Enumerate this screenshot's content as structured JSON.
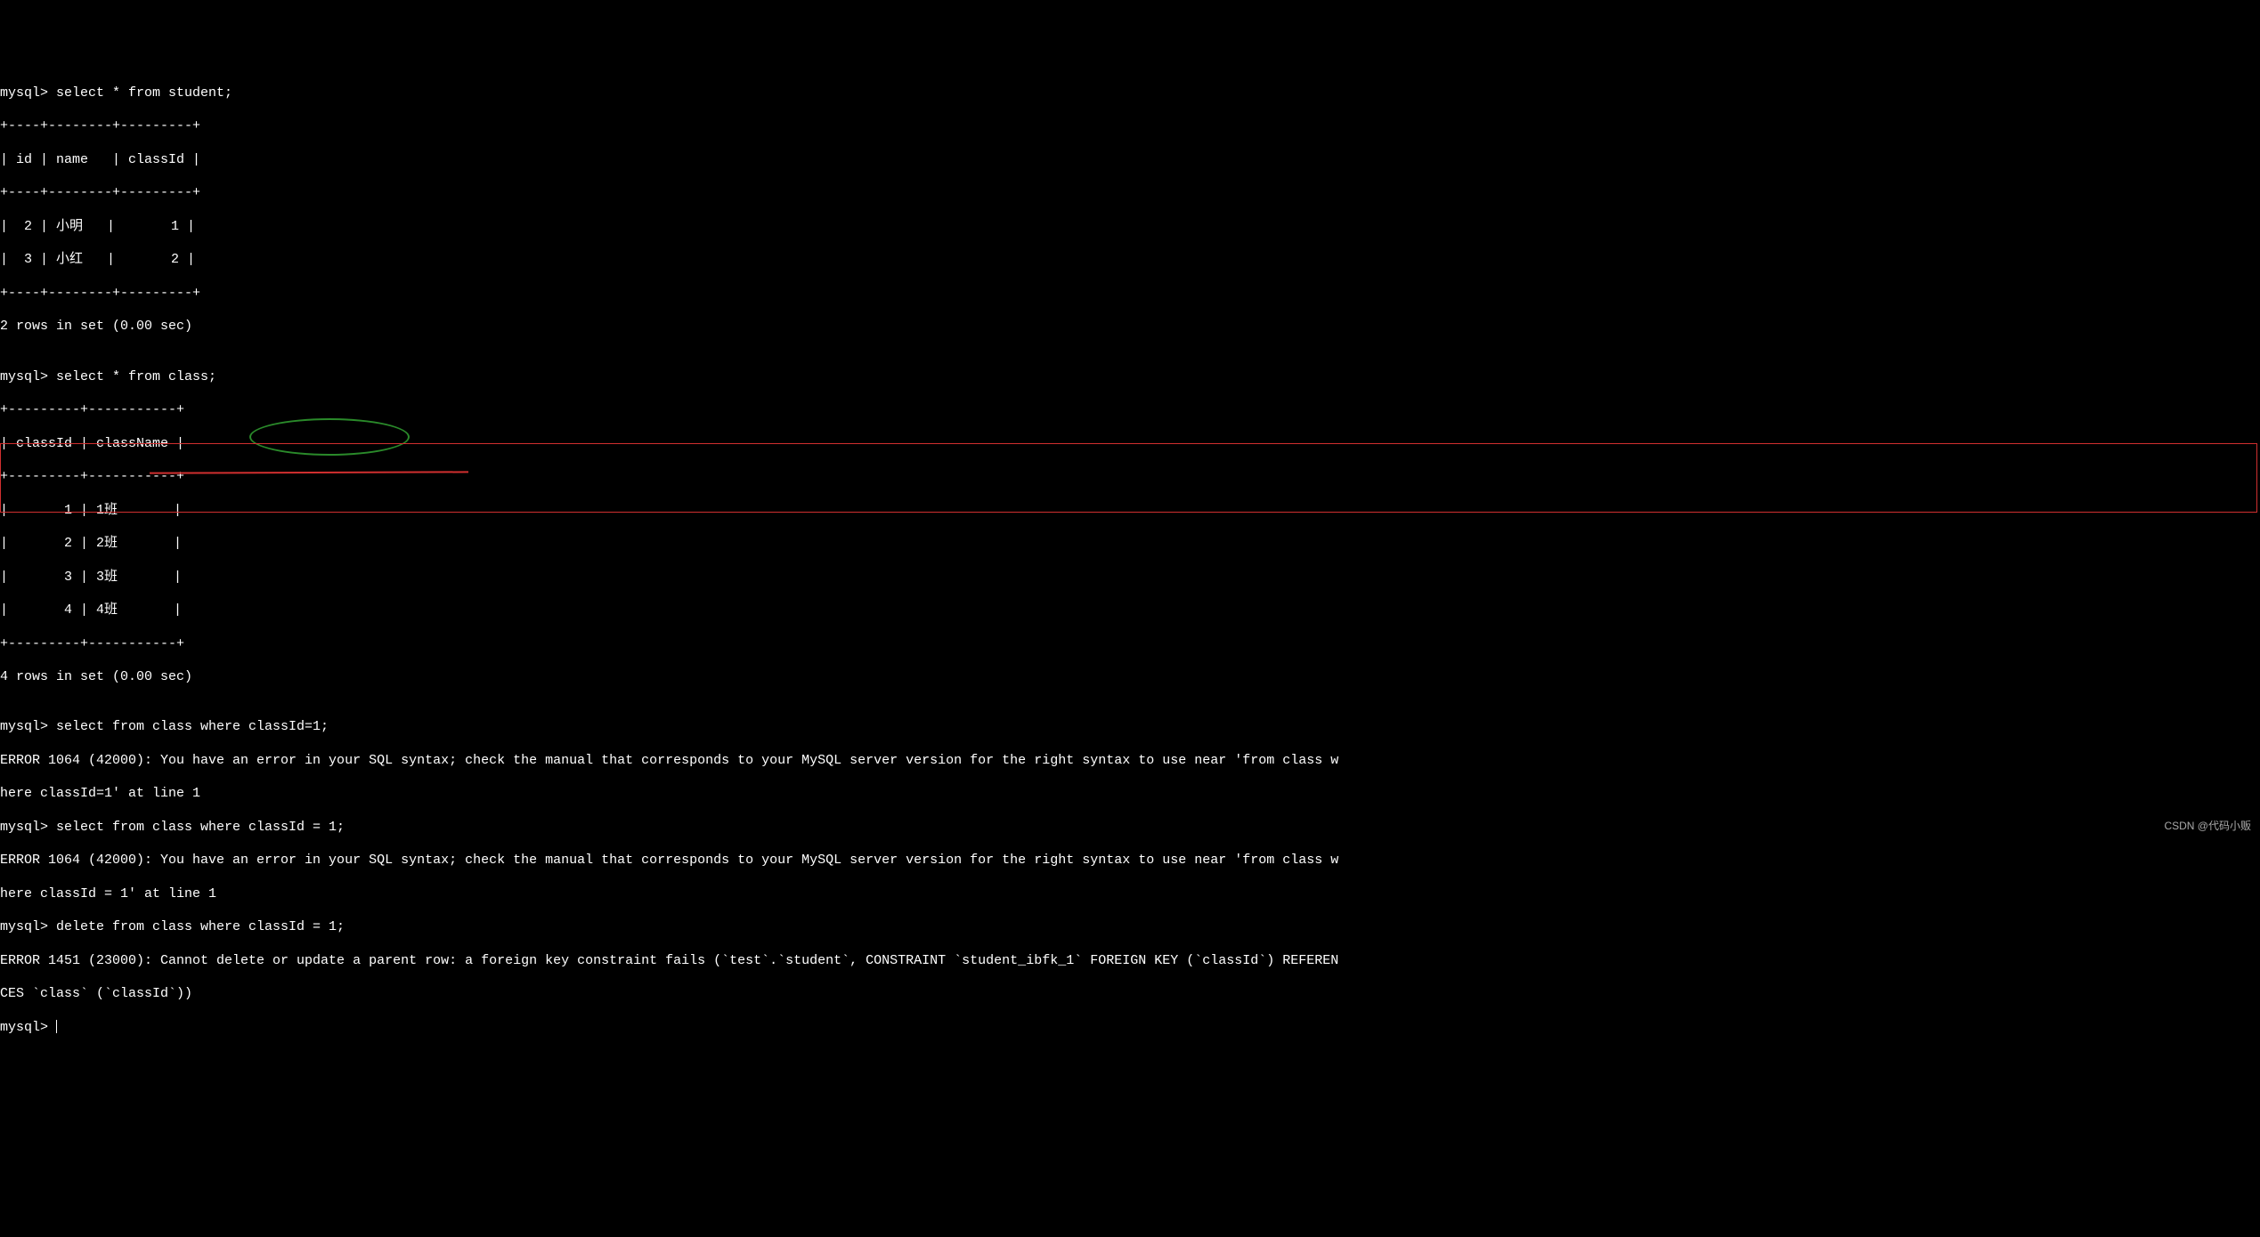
{
  "terminal": {
    "lines": [
      "mysql> select * from student;",
      "+----+--------+---------+",
      "| id | name   | classId |",
      "+----+--------+---------+",
      "|  2 | 小明   |       1 |",
      "|  3 | 小红   |       2 |",
      "+----+--------+---------+",
      "2 rows in set (0.00 sec)",
      "",
      "mysql> select * from class;",
      "+---------+-----------+",
      "| classId | className |",
      "+---------+-----------+",
      "|       1 | 1班       |",
      "|       2 | 2班       |",
      "|       3 | 3班       |",
      "|       4 | 4班       |",
      "+---------+-----------+",
      "4 rows in set (0.00 sec)",
      "",
      "mysql> select from class where classId=1;",
      "ERROR 1064 (42000): You have an error in your SQL syntax; check the manual that corresponds to your MySQL server version for the right syntax to use near 'from class w",
      "here classId=1' at line 1",
      "mysql> select from class where classId = 1;",
      "ERROR 1064 (42000): You have an error in your SQL syntax; check the manual that corresponds to your MySQL server version for the right syntax to use near 'from class w",
      "here classId = 1' at line 1",
      "mysql> delete from class where classId = 1;",
      "ERROR 1451 (23000): Cannot delete or update a parent row: a foreign key constraint fails (`test`.`student`, CONSTRAINT `student_ibfk_1` FOREIGN KEY (`classId`) REFEREN",
      "CES `class` (`classId`))",
      "mysql> "
    ],
    "prompt_final": "mysql> "
  },
  "queries": {
    "select_student": "select * from student;",
    "select_class": "select * from class;",
    "select_class_id1_a": "select from class where classId=1;",
    "select_class_id1_b": "select from class where classId = 1;",
    "delete_class_id1": "delete from class where classId = 1;"
  },
  "tables": {
    "student": {
      "columns": [
        "id",
        "name",
        "classId"
      ],
      "rows": [
        {
          "id": 2,
          "name": "小明",
          "classId": 1
        },
        {
          "id": 3,
          "name": "小红",
          "classId": 2
        }
      ],
      "rowcount_msg": "2 rows in set (0.00 sec)"
    },
    "class": {
      "columns": [
        "classId",
        "className"
      ],
      "rows": [
        {
          "classId": 1,
          "className": "1班"
        },
        {
          "classId": 2,
          "className": "2班"
        },
        {
          "classId": 3,
          "className": "3班"
        },
        {
          "classId": 4,
          "className": "4班"
        }
      ],
      "rowcount_msg": "4 rows in set (0.00 sec)"
    }
  },
  "errors": {
    "e1064_a": "ERROR 1064 (42000): You have an error in your SQL syntax; check the manual that corresponds to your MySQL server version for the right syntax to use near 'from class where classId=1' at line 1",
    "e1064_b": "ERROR 1064 (42000): You have an error in your SQL syntax; check the manual that corresponds to your MySQL server version for the right syntax to use near 'from class where classId = 1' at line 1",
    "e1451": "ERROR 1451 (23000): Cannot delete or update a parent row: a foreign key constraint fails (`test`.`student`, CONSTRAINT `student_ibfk_1` FOREIGN KEY (`classId`) REFERENCES `class` (`classId`))"
  },
  "watermark": "CSDN @代码小贩"
}
